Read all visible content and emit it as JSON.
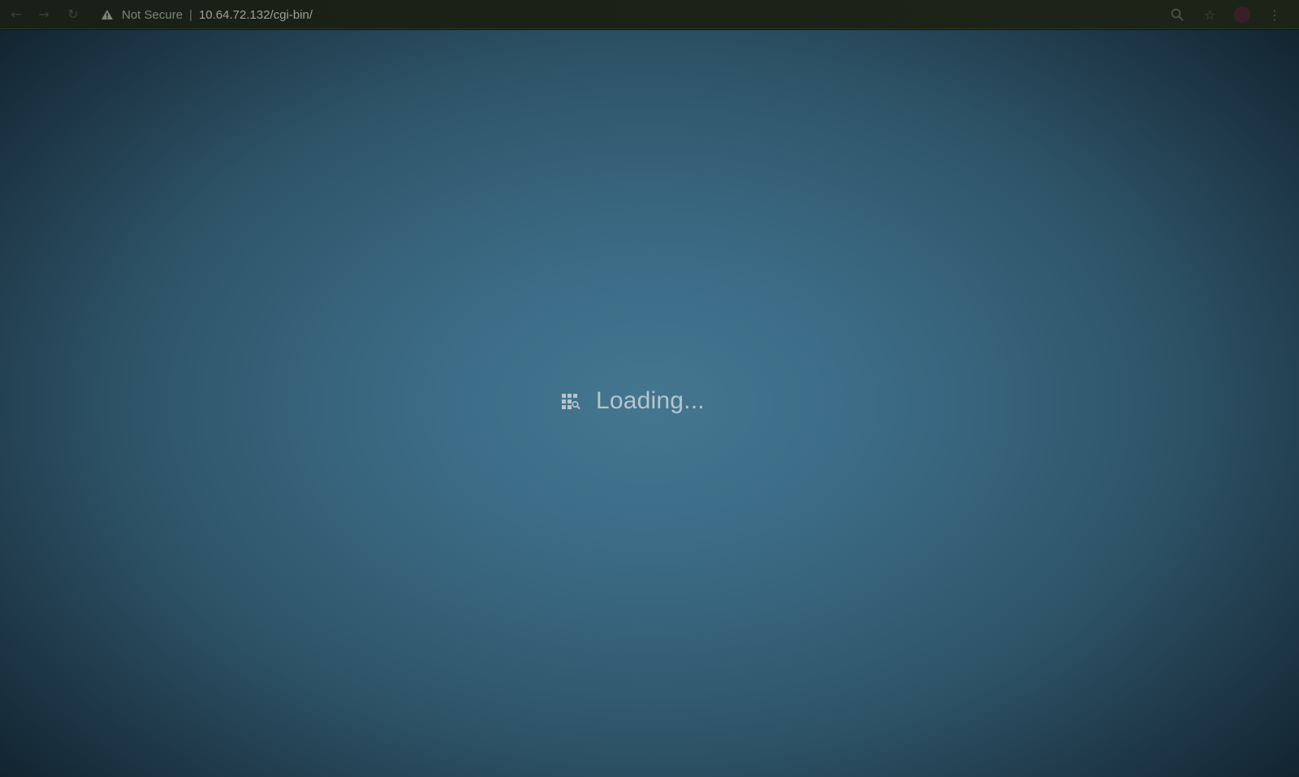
{
  "browser": {
    "nav": {
      "back_icon": "arrow-left-icon",
      "forward_icon": "arrow-right-icon",
      "reload_icon": "reload-icon"
    },
    "address_bar": {
      "security_label": "Not Secure",
      "separator": "|",
      "url": "10.64.72.132/cgi-bin/"
    },
    "right_icons": [
      "zoom-icon",
      "star-icon",
      "avatar",
      "menu-kebab-icon"
    ]
  },
  "page": {
    "loading_text": "Loading...",
    "loading_icon": "grid-search-icon",
    "colors": {
      "background_center": "#43768f",
      "background_edge": "#10202b",
      "text": "#b9c4ca"
    }
  }
}
